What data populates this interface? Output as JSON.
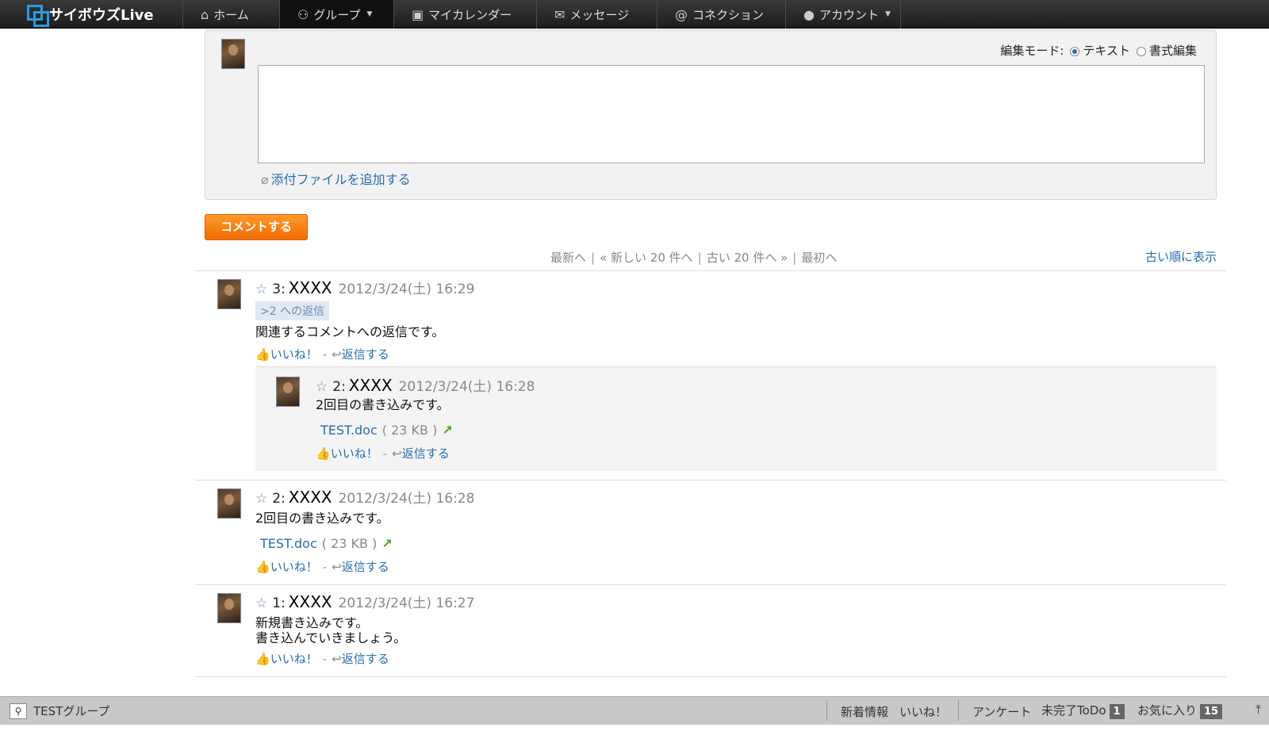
{
  "nav": {
    "logo": "サイボウズLive",
    "items": [
      {
        "label": "ホーム",
        "icon": "home-icon"
      },
      {
        "label": "グループ",
        "icon": "group-icon"
      },
      {
        "label": "マイカレンダー",
        "icon": "calendar-icon"
      },
      {
        "label": "メッセージ",
        "icon": "mail-icon"
      },
      {
        "label": "コネクション",
        "icon": "at-icon"
      },
      {
        "label": "アカウント",
        "icon": "user-icon"
      }
    ]
  },
  "composer": {
    "edit_mode_label": "編集モード:",
    "mode_text": "テキスト",
    "mode_rich": "書式編集",
    "textarea_value": "",
    "attach_label": "添付ファイルを追加する",
    "submit_label": "コメントする"
  },
  "pager": {
    "latest": "最新へ",
    "newer": "« 新しい 20 件へ",
    "older": "古い 20 件へ »",
    "first": "最初へ",
    "separator": "|",
    "sort_label": "古い順に表示"
  },
  "posts": [
    {
      "number": "3:",
      "author": "XXXX",
      "time": "2012/3/24(土) 16:29",
      "reply_to": ">2 への返信",
      "body": "関連するコメントへの返信です。",
      "like_label": "いいね！",
      "reply_label": "返信する",
      "dash": "-",
      "quoted": {
        "number": "2:",
        "author": "XXXX",
        "time": "2012/3/24(土) 16:28",
        "body": "2回目の書き込みです。",
        "file_name": "TEST.doc",
        "file_size": "( 23 KB )",
        "like_label": "いいね！",
        "reply_label": "返信する"
      }
    },
    {
      "number": "2:",
      "author": "XXXX",
      "time": "2012/3/24(土) 16:28",
      "body": "2回目の書き込みです。",
      "file_name": "TEST.doc",
      "file_size": "( 23 KB )",
      "like_label": "いいね！",
      "reply_label": "返信する"
    },
    {
      "number": "1:",
      "author": "XXXX",
      "time": "2012/3/24(土) 16:27",
      "body_line1": "新規書き込みです。",
      "body_line2": "書き込んでいきましょう。",
      "like_label": "いいね！",
      "reply_label": "返信する"
    }
  ],
  "footer": {
    "group_name": "TESTグループ",
    "news": "新着情報",
    "likes": "いいね！",
    "survey": "アンケート",
    "todo_label": "未完了ToDo",
    "todo_count": "1",
    "favorites_label": "お気に入り",
    "favorites_count": "15"
  },
  "colors": {
    "link": "#2a6db0",
    "button_orange": "#f26b00",
    "logo_blue": "#2d9be0"
  }
}
